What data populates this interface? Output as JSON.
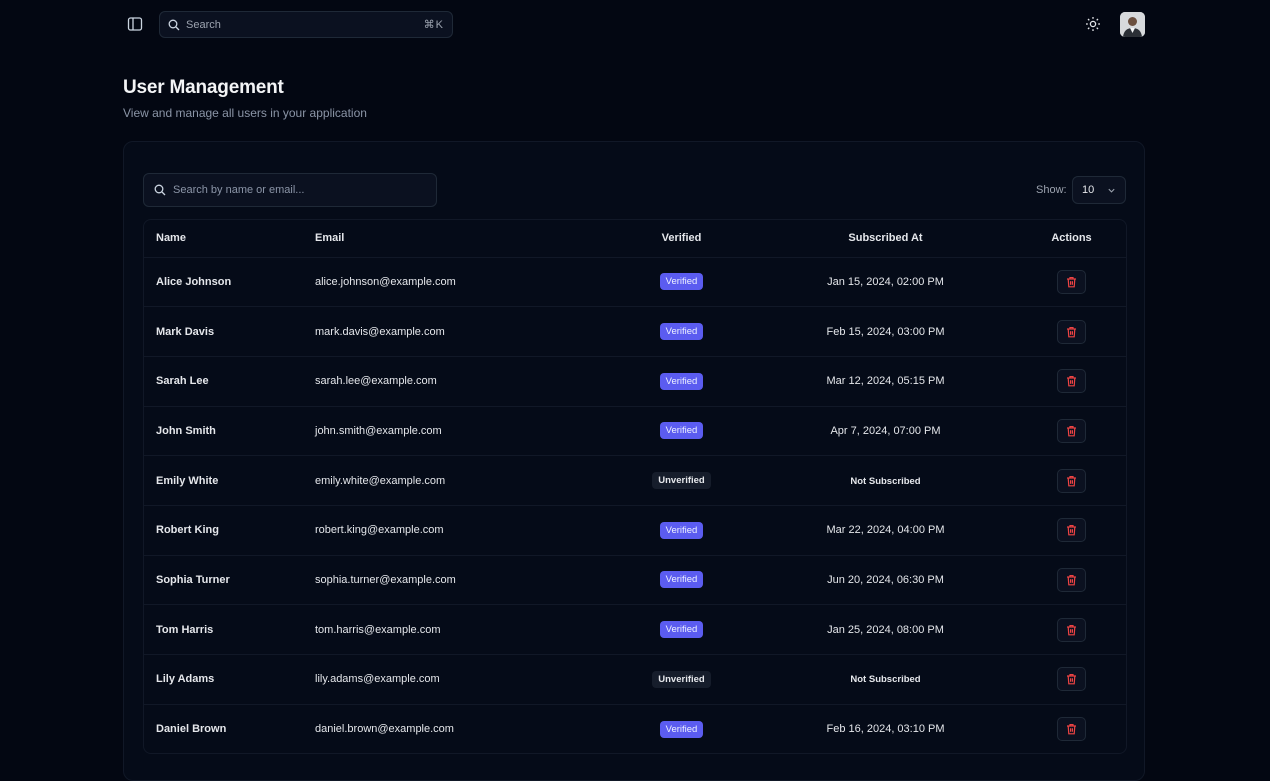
{
  "header": {
    "search_label": "Search",
    "search_shortcut": "⌘K",
    "icons": {
      "sidebar": "sidebar-toggle-icon",
      "search": "search-icon",
      "theme": "sun-icon",
      "avatar": "user-avatar"
    }
  },
  "page": {
    "title": "User Management",
    "subtitle": "View and manage all users in your application"
  },
  "toolbar": {
    "search_placeholder": "Search by name or email...",
    "show_label": "Show:",
    "page_size": "10"
  },
  "table": {
    "columns": [
      "Name",
      "Email",
      "Verified",
      "Subscribed At",
      "Actions"
    ],
    "rows": [
      {
        "name": "Alice Johnson",
        "email": "alice.johnson@example.com",
        "verified": "Verified",
        "is_verified": true,
        "subscribed_at": "Jan 15, 2024, 02:00 PM"
      },
      {
        "name": "Mark Davis",
        "email": "mark.davis@example.com",
        "verified": "Verified",
        "is_verified": true,
        "subscribed_at": "Feb 15, 2024, 03:00 PM"
      },
      {
        "name": "Sarah Lee",
        "email": "sarah.lee@example.com",
        "verified": "Verified",
        "is_verified": true,
        "subscribed_at": "Mar 12, 2024, 05:15 PM"
      },
      {
        "name": "John Smith",
        "email": "john.smith@example.com",
        "verified": "Verified",
        "is_verified": true,
        "subscribed_at": "Apr 7, 2024, 07:00 PM"
      },
      {
        "name": "Emily White",
        "email": "emily.white@example.com",
        "verified": "Unverified",
        "is_verified": false,
        "subscribed_at": "Not Subscribed"
      },
      {
        "name": "Robert King",
        "email": "robert.king@example.com",
        "verified": "Verified",
        "is_verified": true,
        "subscribed_at": "Mar 22, 2024, 04:00 PM"
      },
      {
        "name": "Sophia Turner",
        "email": "sophia.turner@example.com",
        "verified": "Verified",
        "is_verified": true,
        "subscribed_at": "Jun 20, 2024, 06:30 PM"
      },
      {
        "name": "Tom Harris",
        "email": "tom.harris@example.com",
        "verified": "Verified",
        "is_verified": true,
        "subscribed_at": "Jan 25, 2024, 08:00 PM"
      },
      {
        "name": "Lily Adams",
        "email": "lily.adams@example.com",
        "verified": "Unverified",
        "is_verified": false,
        "subscribed_at": "Not Subscribed"
      },
      {
        "name": "Daniel Brown",
        "email": "daniel.brown@example.com",
        "verified": "Verified",
        "is_verified": true,
        "subscribed_at": "Feb 16, 2024, 03:10 PM"
      }
    ]
  },
  "colors": {
    "background": "#030712",
    "verified_badge": "#5b5cf0",
    "delete_icon": "#ef4444"
  }
}
